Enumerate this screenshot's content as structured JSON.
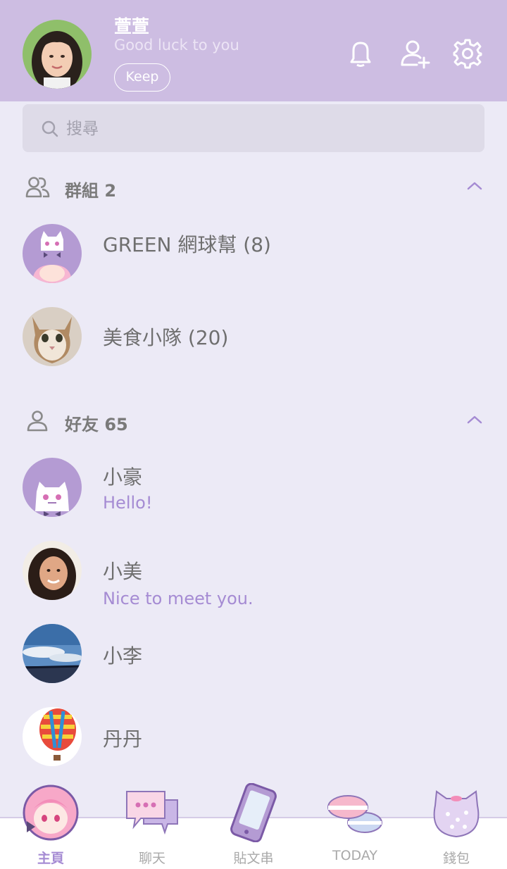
{
  "header": {
    "profile_name": "萱萱",
    "status_message": "Good luck to you",
    "keep_label": "Keep"
  },
  "search": {
    "placeholder": "搜尋"
  },
  "groups": {
    "title": "群組 2",
    "items": [
      {
        "name": "GREEN 網球幫 (8)"
      },
      {
        "name": "美食小隊 (20)"
      }
    ]
  },
  "friends": {
    "title": "好友 65",
    "items": [
      {
        "name": "小豪",
        "message": "Hello!"
      },
      {
        "name": "小美",
        "message": "Nice to meet you."
      },
      {
        "name": "小李"
      },
      {
        "name": "丹丹"
      }
    ]
  },
  "nav": {
    "items": [
      {
        "label": "主頁",
        "icon": "anime-girl-icon"
      },
      {
        "label": "聊天",
        "icon": "chat-bubbles-icon"
      },
      {
        "label": "貼文串",
        "icon": "phone-icon"
      },
      {
        "label": "TODAY",
        "icon": "macaron-icon"
      },
      {
        "label": "錢包",
        "icon": "cat-purse-icon"
      }
    ],
    "active": "主頁"
  },
  "colors": {
    "header_bg": "#CDBDE2",
    "page_bg": "#ECEAF6",
    "accent": "#A58BD3",
    "search_bg": "#DEDBE8"
  }
}
